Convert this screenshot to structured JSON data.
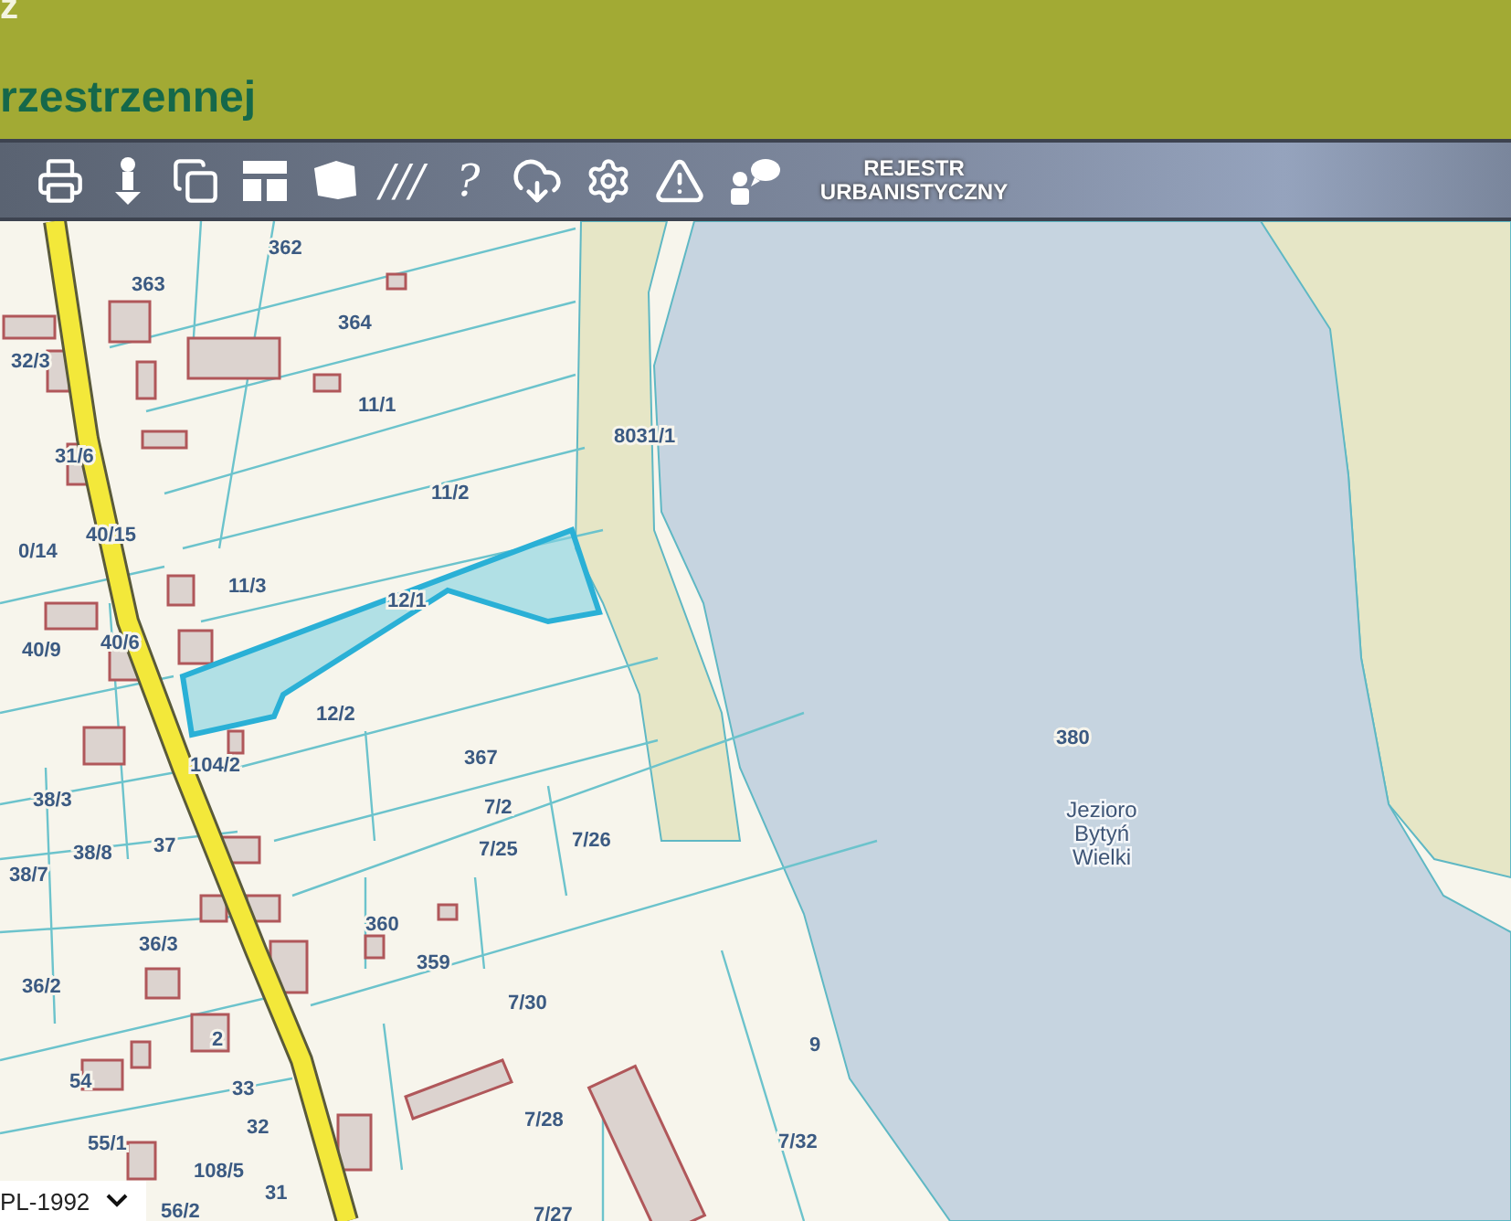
{
  "header": {
    "title_top": "z",
    "title": "rzestrzennej"
  },
  "toolbar": [
    {
      "kind": "icon"
    },
    {
      "kind": "icon"
    },
    {
      "kind": "icon"
    },
    {
      "kind": "icon"
    },
    {
      "kind": "icon"
    },
    {
      "kind": "glyph",
      "text": "///"
    },
    {
      "kind": "glyph",
      "text": "?"
    },
    {
      "kind": "icon"
    },
    {
      "kind": "icon"
    },
    {
      "kind": "icon"
    },
    {
      "kind": "icon"
    },
    {
      "kind": "text",
      "text": "REJESTR URBANISTYCZNY"
    }
  ],
  "map": {
    "parcels": [
      "362",
      "363",
      "364",
      "32/3",
      "11/1",
      "31/6",
      "11/2",
      "8031/1",
      "40/15",
      "0/14",
      "11/3",
      "12/1",
      "40/9",
      "40/6",
      "12/2",
      "104/2",
      "367",
      "38/3",
      "7/2",
      "38/8",
      "37",
      "7/25",
      "7/26",
      "38/7",
      "360",
      "36/3",
      "359",
      "36/2",
      "7/30",
      "2",
      "54",
      "33",
      "32",
      "7/28",
      "55/1",
      "108/5",
      "31",
      "7/27",
      "56/2",
      "380",
      "9",
      "7/32"
    ],
    "lake_name": "Jezioro Bytyń Wielki",
    "projection": "PL-1992"
  }
}
